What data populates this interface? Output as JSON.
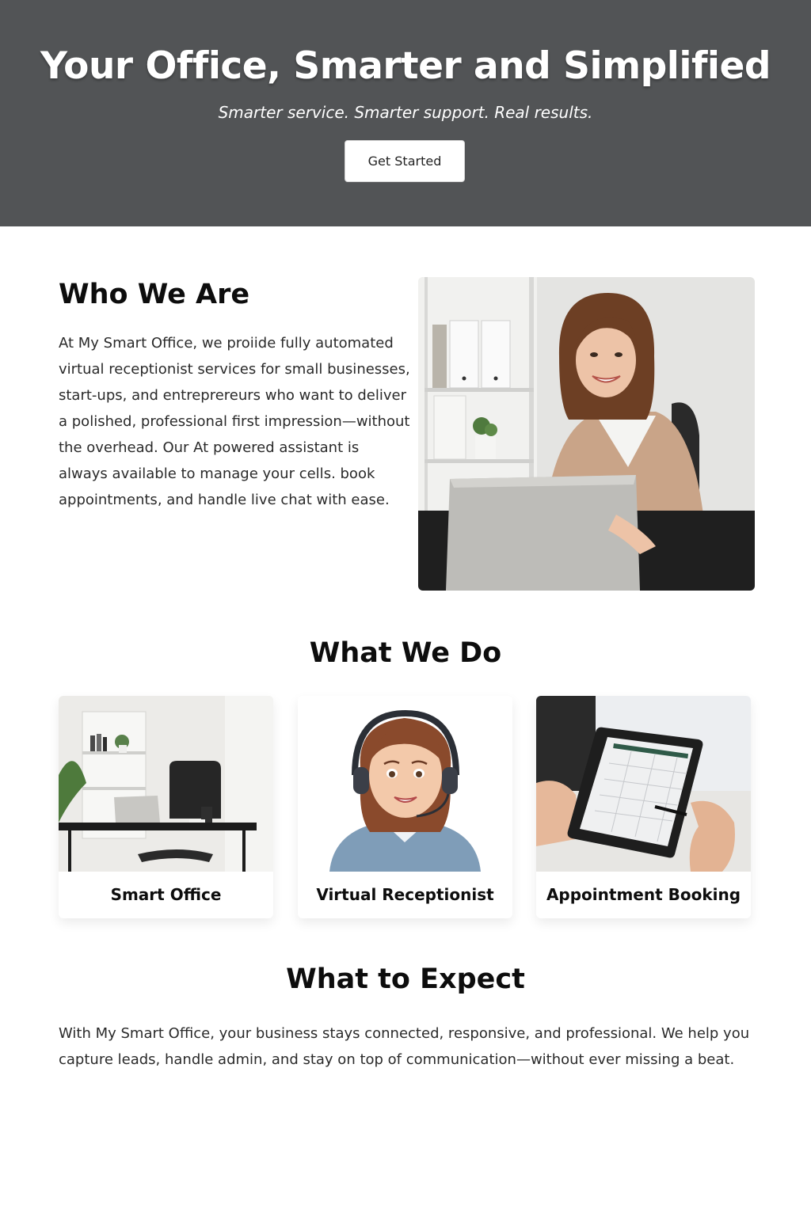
{
  "hero": {
    "title": "Your Office, Smarter and Simplified",
    "subtitle": "Smarter service. Smarter support. Real results.",
    "cta_label": "Get Started",
    "background": "#525456"
  },
  "who": {
    "title": "Who We Are",
    "text": "At My Smart Office, we proiide fully automated virtual receptionist services for small businesses, start-ups, and entreprereurs who want to deliver a polished, professional first impression—without the overhead. Our At powered assistant is always available to manage your cells. book appointments, and handle live chat with ease.",
    "photo": "woman-at-laptop-photo"
  },
  "what_we_do": {
    "title": "What We Do",
    "cards": [
      {
        "label": "Smart Office",
        "image": "office-desk-photo"
      },
      {
        "label": "Virtual Receptionist",
        "image": "receptionist-headset-illustration"
      },
      {
        "label": "Appointment Booking",
        "image": "tablet-calendar-photo"
      }
    ]
  },
  "expect": {
    "title": "What to Expect",
    "text": "With My Smart Office, your business stays connected, responsive, and professional. We help you capture leads, handle admin, and stay on top of communication—without ever missing a beat."
  }
}
